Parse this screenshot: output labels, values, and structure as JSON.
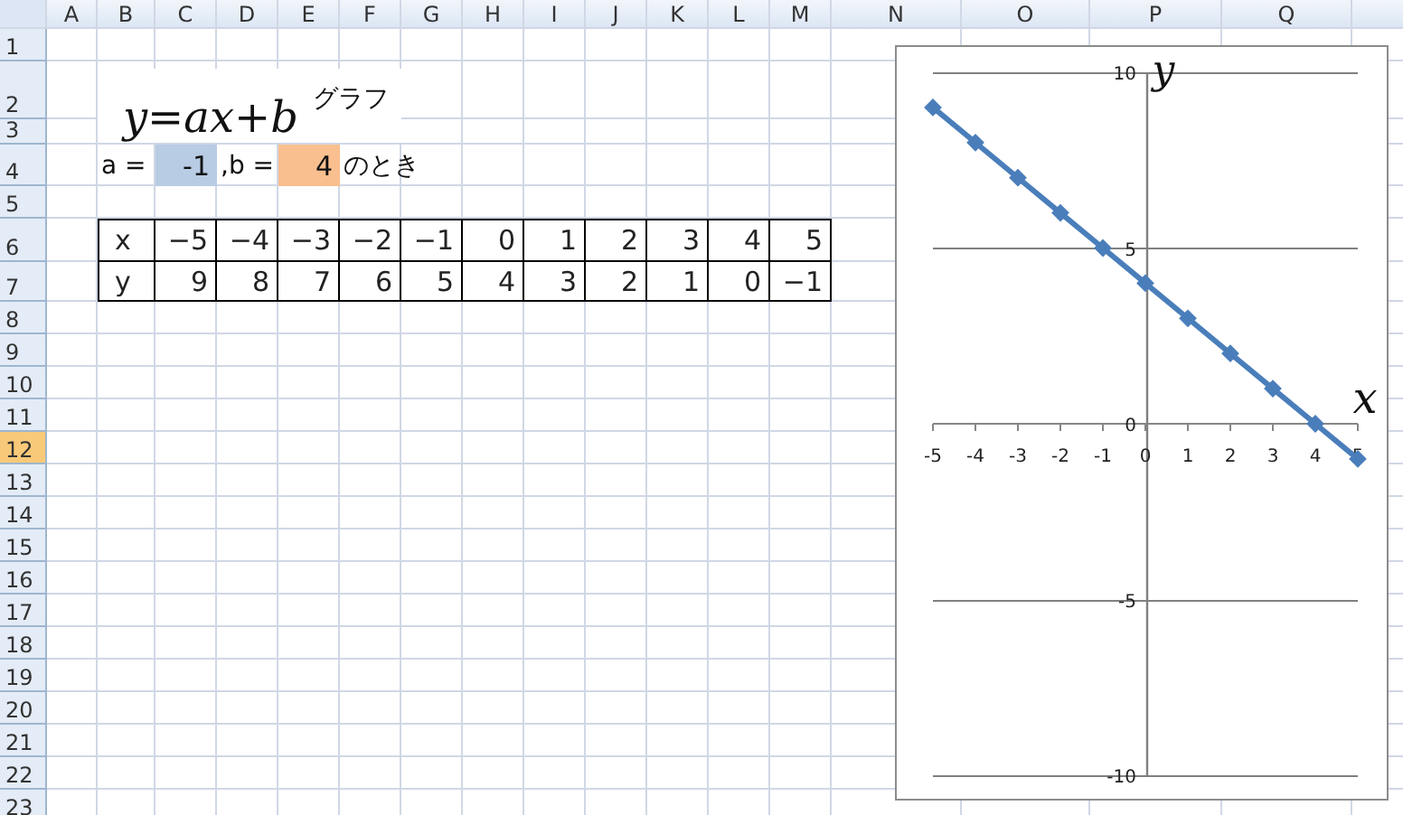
{
  "columns": [
    {
      "label": "A"
    },
    {
      "label": "B"
    },
    {
      "label": "C"
    },
    {
      "label": "D"
    },
    {
      "label": "E"
    },
    {
      "label": "F"
    },
    {
      "label": "G"
    },
    {
      "label": "H"
    },
    {
      "label": "I"
    },
    {
      "label": "J"
    },
    {
      "label": "K"
    },
    {
      "label": "L"
    },
    {
      "label": "M"
    },
    {
      "label": "N"
    },
    {
      "label": "O"
    },
    {
      "label": "P"
    },
    {
      "label": "Q"
    }
  ],
  "rows": [
    {
      "label": "1",
      "selected": false
    },
    {
      "label": "2",
      "selected": false
    },
    {
      "label": "3",
      "selected": false
    },
    {
      "label": "4",
      "selected": false
    },
    {
      "label": "5",
      "selected": false
    },
    {
      "label": "6",
      "selected": false
    },
    {
      "label": "7",
      "selected": false
    },
    {
      "label": "8",
      "selected": false
    },
    {
      "label": "9",
      "selected": false
    },
    {
      "label": "10",
      "selected": false
    },
    {
      "label": "11",
      "selected": false
    },
    {
      "label": "12",
      "selected": true
    },
    {
      "label": "13",
      "selected": false
    },
    {
      "label": "14",
      "selected": false
    },
    {
      "label": "15",
      "selected": false
    },
    {
      "label": "16",
      "selected": false
    },
    {
      "label": "17",
      "selected": false
    },
    {
      "label": "18",
      "selected": false
    },
    {
      "label": "19",
      "selected": false
    },
    {
      "label": "20",
      "selected": false
    },
    {
      "label": "21",
      "selected": false
    },
    {
      "label": "22",
      "selected": false
    },
    {
      "label": "23",
      "selected": false
    }
  ],
  "title": {
    "formula": "y=ax+b",
    "suffix": "グラフ"
  },
  "params": [
    {
      "kind": "label",
      "text": "a ="
    },
    {
      "kind": "value",
      "text": "-1",
      "color": "#b8cce4"
    },
    {
      "kind": "label",
      "text": ",b ="
    },
    {
      "kind": "value",
      "text": "4",
      "color": "#fabf8f"
    },
    {
      "kind": "label",
      "text": "のとき"
    }
  ],
  "table": [
    {
      "header": "x",
      "cells": [
        "−5",
        "−4",
        "−3",
        "−2",
        "−1",
        "0",
        "1",
        "2",
        "3",
        "4",
        "5"
      ]
    },
    {
      "header": "y",
      "cells": [
        "9",
        "8",
        "7",
        "6",
        "5",
        "4",
        "3",
        "2",
        "1",
        "0",
        "−1"
      ]
    }
  ],
  "chart": {
    "chart_data": {
      "type": "line",
      "xlabel": "x",
      "ylabel": "y",
      "x": [
        -5,
        -4,
        -3,
        -2,
        -1,
        0,
        1,
        2,
        3,
        4,
        5
      ],
      "series": [
        {
          "color": "#4a7ebb",
          "marker": "diamond",
          "values": [
            9,
            8,
            7,
            6,
            5,
            4,
            3,
            2,
            1,
            0,
            -1
          ]
        }
      ],
      "grid": true,
      "xlim": [
        -5,
        5
      ],
      "ylim": [
        -10,
        10
      ],
      "xticks": [
        -5,
        -4,
        -3,
        -2,
        -1,
        0,
        1,
        2,
        3,
        4,
        5
      ],
      "yticks": [
        -10,
        -5,
        0,
        5,
        10
      ]
    }
  }
}
